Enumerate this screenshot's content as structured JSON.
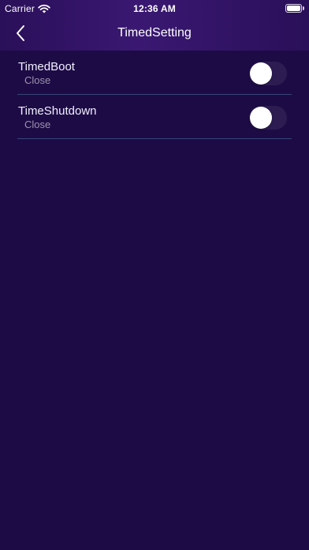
{
  "statusbar": {
    "carrier": "Carrier",
    "time": "12:36 AM",
    "battery_level": 0.95
  },
  "navbar": {
    "title": "TimedSetting",
    "back_icon": "chevron-left-icon"
  },
  "settings": [
    {
      "title": "TimedBoot",
      "subtitle": "Close",
      "enabled": false
    },
    {
      "title": "TimeShutdown",
      "subtitle": "Close",
      "enabled": false
    }
  ],
  "colors": {
    "background": "#1d0b45",
    "header": "#35166d",
    "divider": "#4d78a0",
    "text": "#ffffff",
    "subtext": "#9a92b8"
  }
}
